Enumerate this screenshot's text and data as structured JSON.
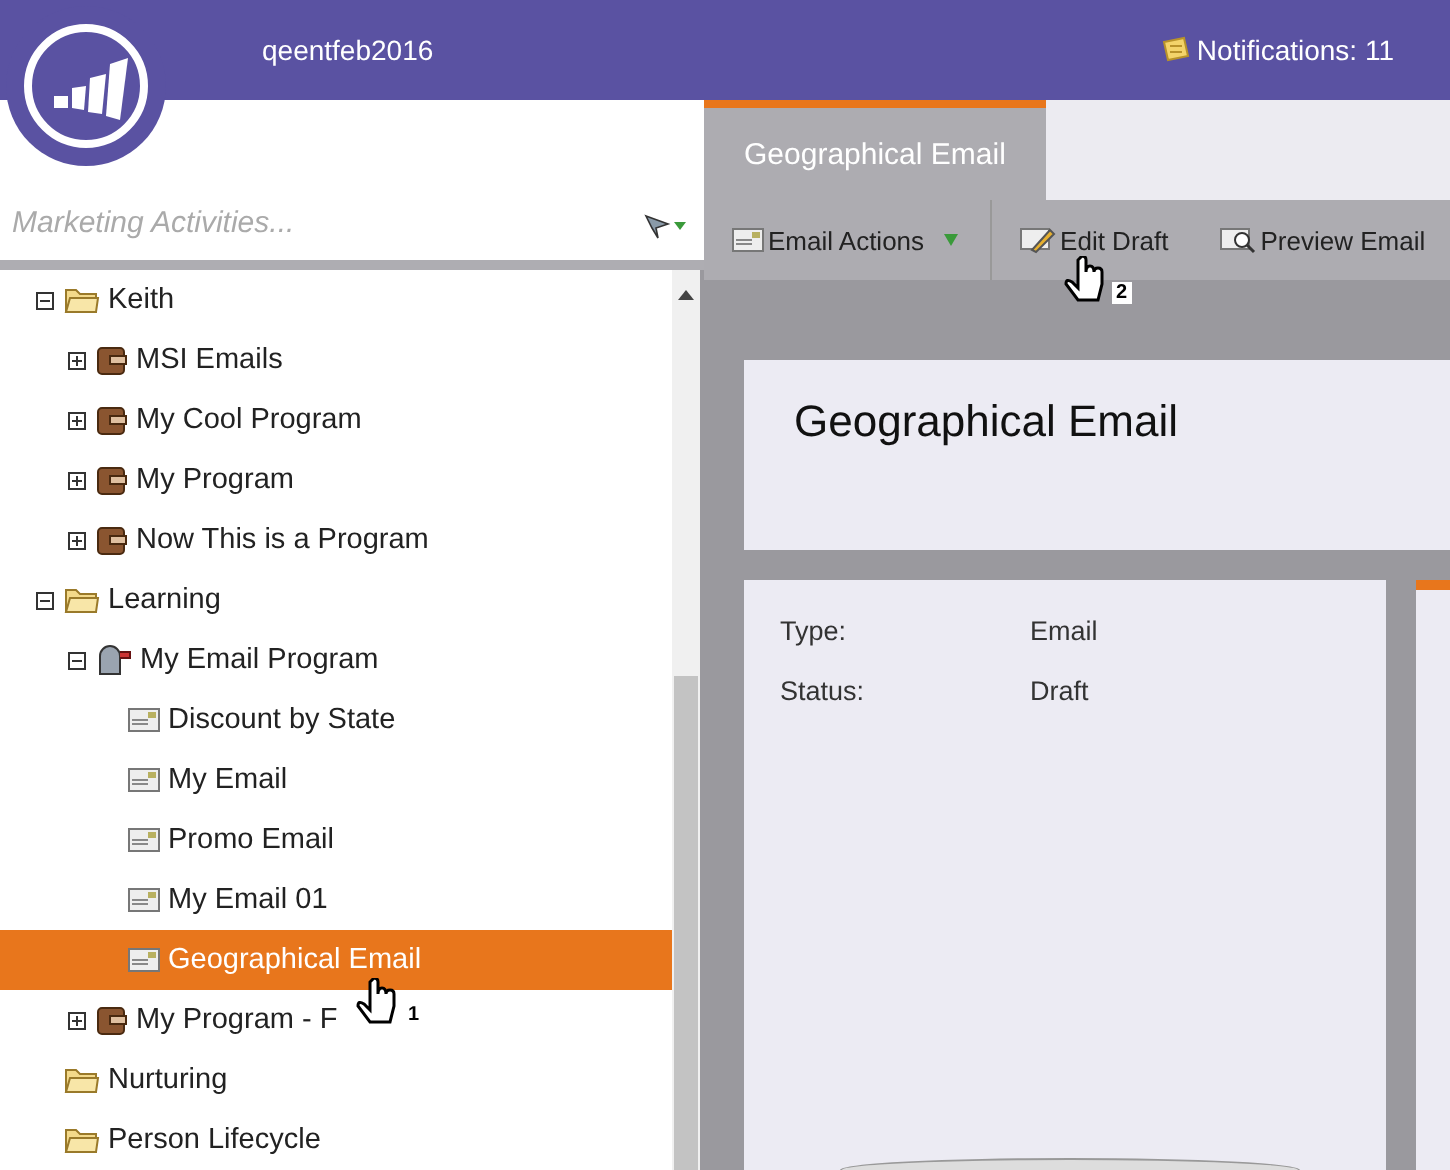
{
  "header": {
    "account": "qeentfeb2016",
    "notifications": "Notifications: 11"
  },
  "sidebar": {
    "search": {
      "placeholder": "Marketing Activities..."
    },
    "tree": [
      {
        "label": "Keith",
        "kind": "folder",
        "expanded": true,
        "selected": false,
        "children": [
          {
            "label": "MSI Emails",
            "kind": "program",
            "expanded": false,
            "selected": false
          },
          {
            "label": "My Cool Program",
            "kind": "program",
            "expanded": false,
            "selected": false
          },
          {
            "label": "My Program",
            "kind": "program",
            "expanded": false,
            "selected": false
          },
          {
            "label": "Now This is a Program",
            "kind": "program",
            "expanded": false,
            "selected": false
          }
        ]
      },
      {
        "label": "Learning",
        "kind": "folder",
        "expanded": true,
        "selected": false,
        "children": [
          {
            "label": "My Email Program",
            "kind": "email-program",
            "expanded": true,
            "selected": false,
            "children": [
              {
                "label": "Discount by State",
                "kind": "email",
                "selected": false
              },
              {
                "label": "My Email",
                "kind": "email",
                "selected": false
              },
              {
                "label": "Promo Email",
                "kind": "email",
                "selected": false
              },
              {
                "label": "My Email 01",
                "kind": "email",
                "selected": false
              },
              {
                "label": "Geographical Email",
                "kind": "email",
                "selected": true,
                "pointer": "1"
              }
            ]
          },
          {
            "label": "My Program - F",
            "kind": "program",
            "expanded": false,
            "selected": false
          }
        ]
      },
      {
        "label": "Nurturing",
        "kind": "folder",
        "selected": false
      },
      {
        "label": "Person Lifecycle",
        "kind": "folder",
        "selected": false
      }
    ]
  },
  "tabs": [
    {
      "label": "Geographical Email",
      "selected": true
    }
  ],
  "toolbar": [
    {
      "label": "Email Actions",
      "kind": "menu"
    },
    {
      "label": "Edit Draft",
      "kind": "edit",
      "pointer": "2"
    },
    {
      "label": "Preview Email",
      "kind": "preview"
    }
  ],
  "asset": {
    "title": "Geographical Email",
    "fields": [
      {
        "label": "Type:",
        "value": "Email"
      },
      {
        "label": "Status:",
        "value": "Draft"
      }
    ]
  }
}
